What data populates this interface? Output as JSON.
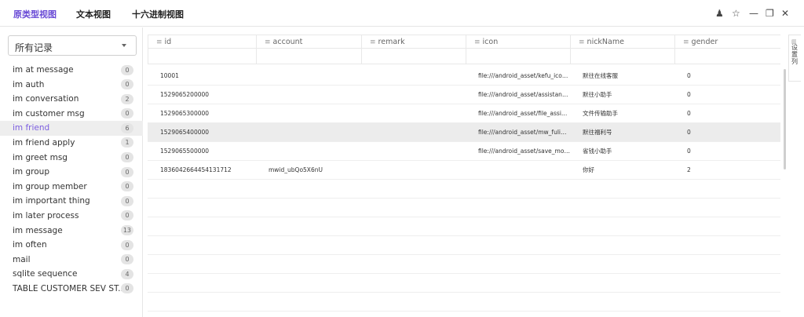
{
  "tabs": [
    {
      "label": "原类型视图",
      "active": true
    },
    {
      "label": "文本视图",
      "active": false
    },
    {
      "label": "十六进制视图",
      "active": false
    }
  ],
  "window_controls": {
    "user": "♟",
    "pin": "☆",
    "minimize": "—",
    "maximize": "❐",
    "close": "✕"
  },
  "sidebar": {
    "select_value": "所有记录",
    "tables": [
      {
        "name": "im at message",
        "count": "0"
      },
      {
        "name": "im auth",
        "count": "0"
      },
      {
        "name": "im conversation",
        "count": "2"
      },
      {
        "name": "im customer msg",
        "count": "0"
      },
      {
        "name": "im friend",
        "count": "6"
      },
      {
        "name": "im friend apply",
        "count": "1"
      },
      {
        "name": "im greet msg",
        "count": "0"
      },
      {
        "name": "im group",
        "count": "0"
      },
      {
        "name": "im group member",
        "count": "0"
      },
      {
        "name": "im important thing",
        "count": "0"
      },
      {
        "name": "im later process",
        "count": "0"
      },
      {
        "name": "im message",
        "count": "13"
      },
      {
        "name": "im often",
        "count": "0"
      },
      {
        "name": "mail",
        "count": "0"
      },
      {
        "name": "sqlite sequence",
        "count": "4"
      },
      {
        "name": "TABLE CUSTOMER SEV ST...",
        "count": "0"
      }
    ]
  },
  "grid": {
    "columns": [
      "id",
      "account",
      "remark",
      "icon",
      "nickName",
      "gender"
    ],
    "rows": [
      {
        "id": "10001",
        "account": "",
        "remark": "",
        "icon": "file:///android_asset/kefu_icon_...",
        "nickName": "默往在线客服",
        "gender": "0"
      },
      {
        "id": "1529065200000",
        "account": "",
        "remark": "",
        "icon": "file:///android_asset/assistant_i...",
        "nickName": "默往小助手",
        "gender": "0"
      },
      {
        "id": "1529065300000",
        "account": "",
        "remark": "",
        "icon": "file:///android_asset/file_assista...",
        "nickName": "文件传输助手",
        "gender": "0"
      },
      {
        "id": "1529065400000",
        "account": "",
        "remark": "",
        "icon": "file:///android_asset/mw_fuliha...",
        "nickName": "默往福利号",
        "gender": "0"
      },
      {
        "id": "1529065500000",
        "account": "",
        "remark": "",
        "icon": "file:///android_asset/save_mon...",
        "nickName": "省钱小助手",
        "gender": "0"
      },
      {
        "id": "1836042664454131712",
        "account": "mwid_ubQo5X6nU",
        "remark": "",
        "icon": "",
        "nickName": "你好",
        "gender": "2"
      }
    ]
  },
  "right_panel": {
    "label": "设置列"
  },
  "colors": {
    "accent": "#6a4bd6",
    "selected_bg": "#ececec"
  }
}
